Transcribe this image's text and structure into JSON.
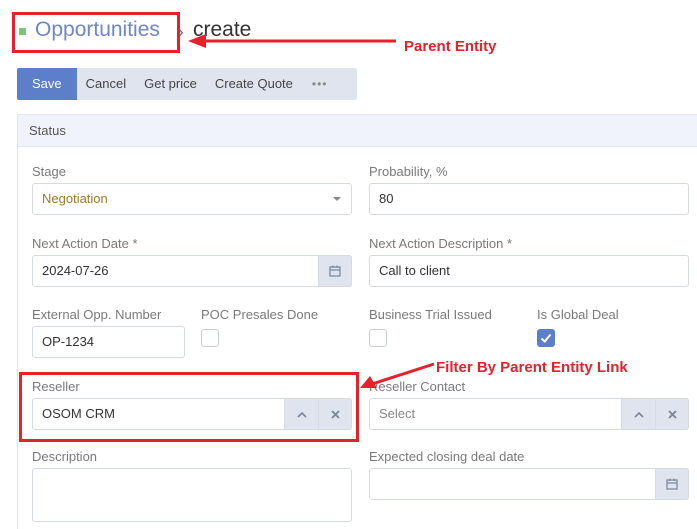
{
  "breadcrumb": {
    "parent": "Opportunities",
    "separator": "›",
    "current": "create"
  },
  "annotations": {
    "parent_entity": "Parent Entity",
    "filter_link": "Filter By Parent Entity Link",
    "color": "#e8202a"
  },
  "toolbar": {
    "save": "Save",
    "cancel": "Cancel",
    "get_price": "Get price",
    "create_quote": "Create Quote",
    "more": "•••"
  },
  "panel": {
    "title": "Status"
  },
  "fields": {
    "stage": {
      "label": "Stage",
      "value": "Negotiation"
    },
    "probability": {
      "label": "Probability, %",
      "value": "80"
    },
    "next_action_date": {
      "label": "Next Action Date *",
      "value": "2024-07-26"
    },
    "next_action_description": {
      "label": "Next Action Description *",
      "value": "Call to client"
    },
    "external_opp_number": {
      "label": "External Opp. Number",
      "value": "OP-1234"
    },
    "poc_presales_done": {
      "label": "POC Presales Done",
      "checked": false
    },
    "business_trial_issued": {
      "label": "Business Trial Issued",
      "checked": false
    },
    "is_global_deal": {
      "label": "Is Global Deal",
      "checked": true
    },
    "reseller": {
      "label": "Reseller",
      "value": "OSOM CRM"
    },
    "reseller_contact": {
      "label": "Reseller Contact",
      "placeholder": "Select"
    },
    "description": {
      "label": "Description",
      "value": ""
    },
    "expected_closing_date": {
      "label": "Expected closing deal date",
      "value": ""
    }
  },
  "colors": {
    "accent": "#5d7fc9",
    "link": "#6f86c9",
    "stage_text": "#9a7b28"
  }
}
